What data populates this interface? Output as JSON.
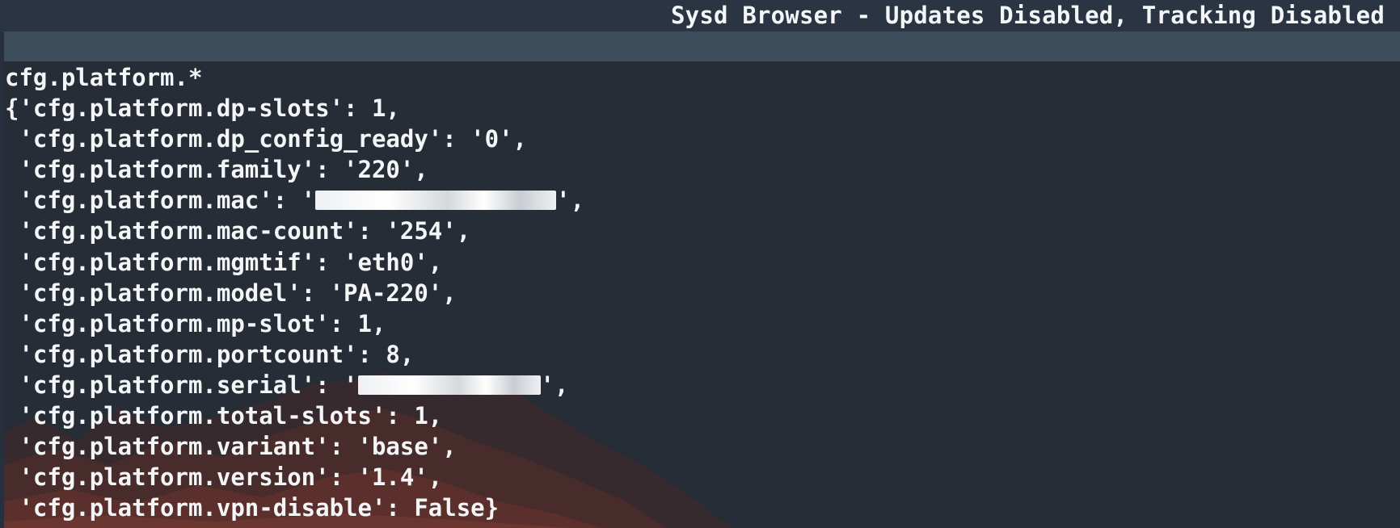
{
  "window": {
    "title": "Sysd Browser - Updates Disabled, Tracking Disabled"
  },
  "terminal": {
    "header_line": "cfg.platform.*",
    "lines": [
      {
        "pre": "{'cfg.platform.dp-slots': 1,",
        "post": ""
      },
      {
        "pre": " 'cfg.platform.dp_config_ready': '0',",
        "post": ""
      },
      {
        "pre": " 'cfg.platform.family': '220',",
        "post": ""
      },
      {
        "pre": " 'cfg.platform.mac': '",
        "post": "',"
      },
      {
        "pre": " 'cfg.platform.mac-count': '254',",
        "post": ""
      },
      {
        "pre": " 'cfg.platform.mgmtif': 'eth0',",
        "post": ""
      },
      {
        "pre": " 'cfg.platform.model': 'PA-220',",
        "post": ""
      },
      {
        "pre": " 'cfg.platform.mp-slot': 1,",
        "post": ""
      },
      {
        "pre": " 'cfg.platform.portcount': 8,",
        "post": ""
      },
      {
        "pre": " 'cfg.platform.serial': '",
        "post": "',"
      },
      {
        "pre": " 'cfg.platform.total-slots': 1,",
        "post": ""
      },
      {
        "pre": " 'cfg.platform.variant': 'base',",
        "post": ""
      },
      {
        "pre": " 'cfg.platform.version': '1.4',",
        "post": ""
      },
      {
        "pre": " 'cfg.platform.vpn-disable': False}",
        "post": ""
      }
    ]
  },
  "colors": {
    "background": "#27303c",
    "toolbar": "#3e4d5b",
    "text": "#f4f5f7",
    "mountain": "#5a2f2c"
  }
}
